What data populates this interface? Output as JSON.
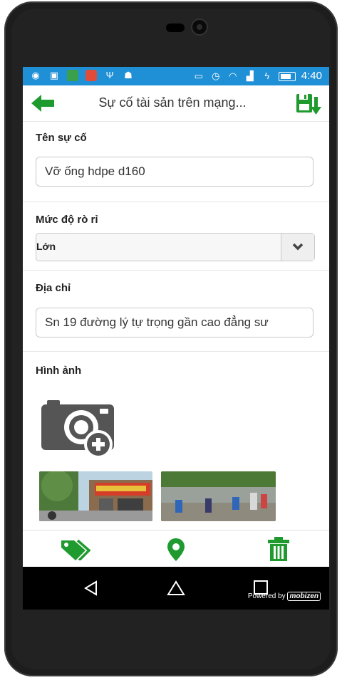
{
  "statusbar": {
    "time": "4:40"
  },
  "appbar": {
    "title": "Sự cố tài sản trên mạng...",
    "back_icon": "arrow-left-icon",
    "save_icon": "save-download-icon"
  },
  "form": {
    "name_label": "Tên sự cố",
    "name_value": "Vỡ ống hdpe d160",
    "severity_label": "Mức độ rò rỉ",
    "severity_value": "Lớn",
    "address_label": "Địa chỉ",
    "address_value": "Sn 19 đường lý tự trọng gần cao đẳng sư",
    "images_label": "Hình ảnh"
  },
  "bottom_actions": [
    "tag-icon",
    "location-pin-icon",
    "trash-icon"
  ],
  "watermark": {
    "prefix": "Powered by",
    "brand": "mobizen"
  },
  "colors": {
    "accent_green": "#1f9a2e",
    "statusbar_blue": "#1f8fd6"
  }
}
